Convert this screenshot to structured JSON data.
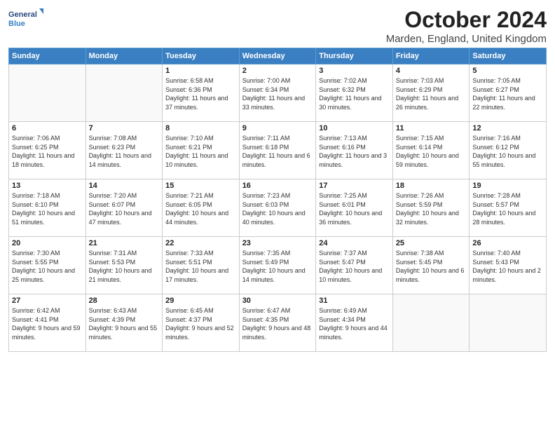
{
  "header": {
    "logo_line1": "General",
    "logo_line2": "Blue",
    "title": "October 2024",
    "location": "Marden, England, United Kingdom"
  },
  "weekdays": [
    "Sunday",
    "Monday",
    "Tuesday",
    "Wednesday",
    "Thursday",
    "Friday",
    "Saturday"
  ],
  "weeks": [
    [
      {
        "day": "",
        "info": ""
      },
      {
        "day": "",
        "info": ""
      },
      {
        "day": "1",
        "info": "Sunrise: 6:58 AM\nSunset: 6:36 PM\nDaylight: 11 hours and 37 minutes."
      },
      {
        "day": "2",
        "info": "Sunrise: 7:00 AM\nSunset: 6:34 PM\nDaylight: 11 hours and 33 minutes."
      },
      {
        "day": "3",
        "info": "Sunrise: 7:02 AM\nSunset: 6:32 PM\nDaylight: 11 hours and 30 minutes."
      },
      {
        "day": "4",
        "info": "Sunrise: 7:03 AM\nSunset: 6:29 PM\nDaylight: 11 hours and 26 minutes."
      },
      {
        "day": "5",
        "info": "Sunrise: 7:05 AM\nSunset: 6:27 PM\nDaylight: 11 hours and 22 minutes."
      }
    ],
    [
      {
        "day": "6",
        "info": "Sunrise: 7:06 AM\nSunset: 6:25 PM\nDaylight: 11 hours and 18 minutes."
      },
      {
        "day": "7",
        "info": "Sunrise: 7:08 AM\nSunset: 6:23 PM\nDaylight: 11 hours and 14 minutes."
      },
      {
        "day": "8",
        "info": "Sunrise: 7:10 AM\nSunset: 6:21 PM\nDaylight: 11 hours and 10 minutes."
      },
      {
        "day": "9",
        "info": "Sunrise: 7:11 AM\nSunset: 6:18 PM\nDaylight: 11 hours and 6 minutes."
      },
      {
        "day": "10",
        "info": "Sunrise: 7:13 AM\nSunset: 6:16 PM\nDaylight: 11 hours and 3 minutes."
      },
      {
        "day": "11",
        "info": "Sunrise: 7:15 AM\nSunset: 6:14 PM\nDaylight: 10 hours and 59 minutes."
      },
      {
        "day": "12",
        "info": "Sunrise: 7:16 AM\nSunset: 6:12 PM\nDaylight: 10 hours and 55 minutes."
      }
    ],
    [
      {
        "day": "13",
        "info": "Sunrise: 7:18 AM\nSunset: 6:10 PM\nDaylight: 10 hours and 51 minutes."
      },
      {
        "day": "14",
        "info": "Sunrise: 7:20 AM\nSunset: 6:07 PM\nDaylight: 10 hours and 47 minutes."
      },
      {
        "day": "15",
        "info": "Sunrise: 7:21 AM\nSunset: 6:05 PM\nDaylight: 10 hours and 44 minutes."
      },
      {
        "day": "16",
        "info": "Sunrise: 7:23 AM\nSunset: 6:03 PM\nDaylight: 10 hours and 40 minutes."
      },
      {
        "day": "17",
        "info": "Sunrise: 7:25 AM\nSunset: 6:01 PM\nDaylight: 10 hours and 36 minutes."
      },
      {
        "day": "18",
        "info": "Sunrise: 7:26 AM\nSunset: 5:59 PM\nDaylight: 10 hours and 32 minutes."
      },
      {
        "day": "19",
        "info": "Sunrise: 7:28 AM\nSunset: 5:57 PM\nDaylight: 10 hours and 28 minutes."
      }
    ],
    [
      {
        "day": "20",
        "info": "Sunrise: 7:30 AM\nSunset: 5:55 PM\nDaylight: 10 hours and 25 minutes."
      },
      {
        "day": "21",
        "info": "Sunrise: 7:31 AM\nSunset: 5:53 PM\nDaylight: 10 hours and 21 minutes."
      },
      {
        "day": "22",
        "info": "Sunrise: 7:33 AM\nSunset: 5:51 PM\nDaylight: 10 hours and 17 minutes."
      },
      {
        "day": "23",
        "info": "Sunrise: 7:35 AM\nSunset: 5:49 PM\nDaylight: 10 hours and 14 minutes."
      },
      {
        "day": "24",
        "info": "Sunrise: 7:37 AM\nSunset: 5:47 PM\nDaylight: 10 hours and 10 minutes."
      },
      {
        "day": "25",
        "info": "Sunrise: 7:38 AM\nSunset: 5:45 PM\nDaylight: 10 hours and 6 minutes."
      },
      {
        "day": "26",
        "info": "Sunrise: 7:40 AM\nSunset: 5:43 PM\nDaylight: 10 hours and 2 minutes."
      }
    ],
    [
      {
        "day": "27",
        "info": "Sunrise: 6:42 AM\nSunset: 4:41 PM\nDaylight: 9 hours and 59 minutes."
      },
      {
        "day": "28",
        "info": "Sunrise: 6:43 AM\nSunset: 4:39 PM\nDaylight: 9 hours and 55 minutes."
      },
      {
        "day": "29",
        "info": "Sunrise: 6:45 AM\nSunset: 4:37 PM\nDaylight: 9 hours and 52 minutes."
      },
      {
        "day": "30",
        "info": "Sunrise: 6:47 AM\nSunset: 4:35 PM\nDaylight: 9 hours and 48 minutes."
      },
      {
        "day": "31",
        "info": "Sunrise: 6:49 AM\nSunset: 4:34 PM\nDaylight: 9 hours and 44 minutes."
      },
      {
        "day": "",
        "info": ""
      },
      {
        "day": "",
        "info": ""
      }
    ]
  ]
}
